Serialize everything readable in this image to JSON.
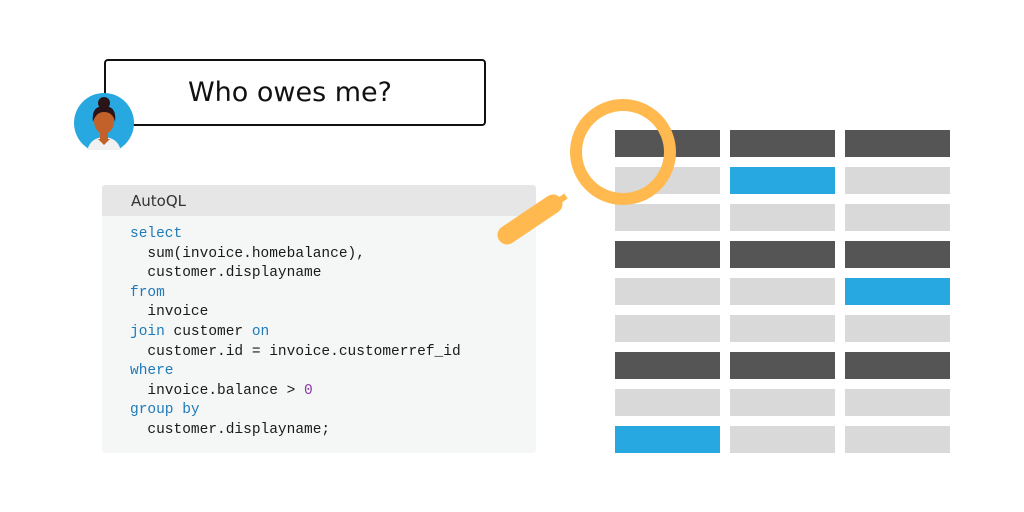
{
  "question": {
    "text": "Who owes me?"
  },
  "avatar": {
    "icon": "user-avatar-icon"
  },
  "panel": {
    "title": "AutoQL",
    "code_lines": [
      {
        "indent": "",
        "tokens": [
          {
            "t": "select",
            "k": "kw"
          }
        ]
      },
      {
        "indent": "  ",
        "tokens": [
          {
            "t": "sum(invoice.homebalance),",
            "k": ""
          }
        ]
      },
      {
        "indent": "  ",
        "tokens": [
          {
            "t": "customer.displayname",
            "k": ""
          }
        ]
      },
      {
        "indent": "",
        "tokens": [
          {
            "t": "from",
            "k": "kw"
          }
        ]
      },
      {
        "indent": "  ",
        "tokens": [
          {
            "t": "invoice",
            "k": ""
          }
        ]
      },
      {
        "indent": "",
        "tokens": [
          {
            "t": "join",
            "k": "kw"
          },
          {
            "t": " customer ",
            "k": ""
          },
          {
            "t": "on",
            "k": "kw"
          }
        ]
      },
      {
        "indent": "  ",
        "tokens": [
          {
            "t": "customer.id = invoice.customerref_id",
            "k": ""
          }
        ]
      },
      {
        "indent": "",
        "tokens": [
          {
            "t": "where",
            "k": "kw"
          }
        ]
      },
      {
        "indent": "  ",
        "tokens": [
          {
            "t": "invoice.balance > ",
            "k": ""
          },
          {
            "t": "0",
            "k": "num"
          }
        ]
      },
      {
        "indent": "",
        "tokens": [
          {
            "t": "group by",
            "k": "kw"
          }
        ]
      },
      {
        "indent": "  ",
        "tokens": [
          {
            "t": "customer.displayname;",
            "k": ""
          }
        ]
      }
    ]
  },
  "table_illustration": {
    "colors": {
      "header": "#555555",
      "plain": "#d9d9d9",
      "highlight": "#27a8e0"
    },
    "rows": [
      [
        "header",
        "header",
        "header"
      ],
      [
        "plain",
        "highlight",
        "plain"
      ],
      [
        "plain",
        "plain",
        "plain"
      ],
      [
        "header",
        "header",
        "header"
      ],
      [
        "plain",
        "plain",
        "highlight"
      ],
      [
        "plain",
        "plain",
        "plain"
      ],
      [
        "header",
        "header",
        "header"
      ],
      [
        "plain",
        "plain",
        "plain"
      ],
      [
        "highlight",
        "plain",
        "plain"
      ]
    ]
  },
  "magnifier": {
    "icon": "magnifying-glass-icon",
    "color": "#ffb94f"
  }
}
